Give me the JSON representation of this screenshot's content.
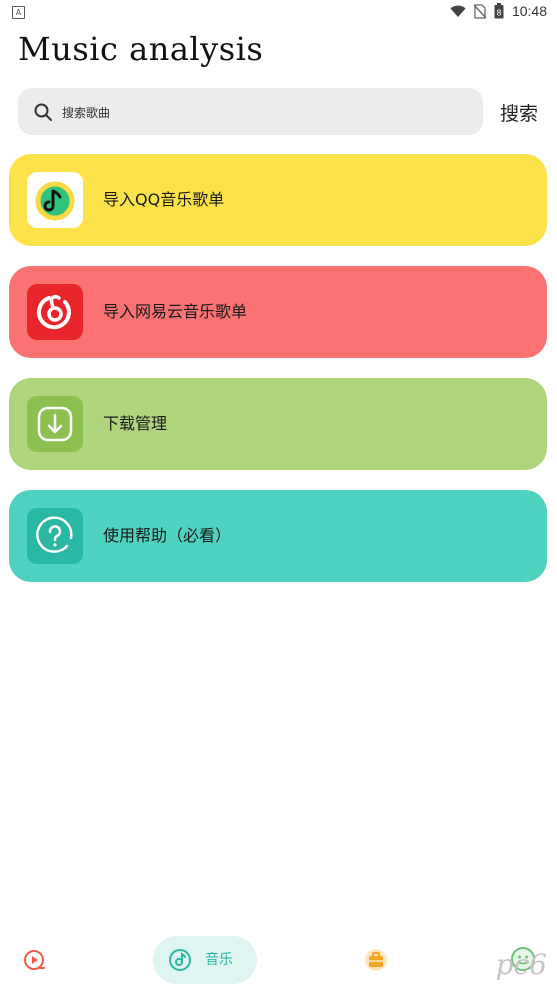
{
  "status_bar": {
    "left_badge": "A",
    "time": "10:48",
    "battery_badge": "8"
  },
  "app": {
    "title": "Music analysis"
  },
  "search": {
    "placeholder": "搜索歌曲",
    "button_label": "搜索"
  },
  "cards": [
    {
      "label": "导入QQ音乐歌单",
      "icon": "qq-music-icon",
      "color": "#fde34a"
    },
    {
      "label": "导入网易云音乐歌单",
      "icon": "netease-music-icon",
      "color": "#fb7272"
    },
    {
      "label": "下载管理",
      "icon": "download-icon",
      "color": "#aed57c"
    },
    {
      "label": "使用帮助（必看）",
      "icon": "help-icon",
      "color": "#4fd2c0"
    }
  ],
  "bottom_nav": {
    "items": [
      {
        "icon": "video-play-icon"
      },
      {
        "icon": "music-disc-icon",
        "label": "音乐",
        "active": true
      },
      {
        "icon": "toolbox-icon"
      },
      {
        "icon": "profile-icon"
      }
    ],
    "accent": "#2ab7a3"
  },
  "watermark": "pc6"
}
